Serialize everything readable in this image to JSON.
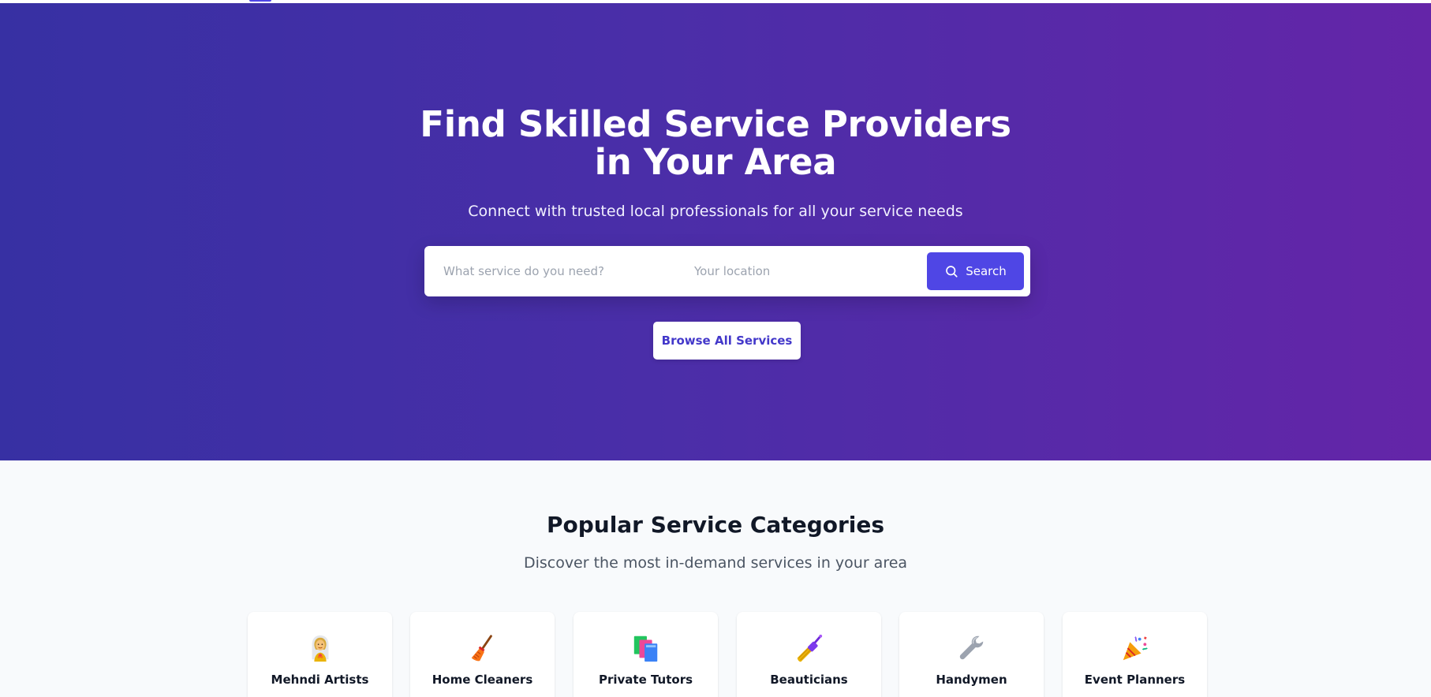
{
  "hero": {
    "title": "Find Skilled Service Providers in Your Area",
    "subtitle": "Connect with trusted local professionals for all your service needs",
    "background_gradient": [
      "#3730a3",
      "#6425a8"
    ]
  },
  "search": {
    "service_placeholder": "What service do you need?",
    "service_value": "",
    "location_placeholder": "Your location",
    "location_value": "",
    "button_label": "Search",
    "button_icon": "search-icon",
    "accent_color": "#4f46e5"
  },
  "browse_button": {
    "label": "Browse All Services"
  },
  "categories": {
    "title": "Popular Service Categories",
    "subtitle": "Discover the most in-demand services in your area",
    "items": [
      {
        "label": "Mehndi Artists",
        "icon": "bride-icon"
      },
      {
        "label": "Home Cleaners",
        "icon": "broom-icon"
      },
      {
        "label": "Private Tutors",
        "icon": "books-icon"
      },
      {
        "label": "Beauticians",
        "icon": "nail-polish-icon"
      },
      {
        "label": "Handymen",
        "icon": "wrench-icon"
      },
      {
        "label": "Event Planners",
        "icon": "party-popper-icon"
      }
    ]
  }
}
